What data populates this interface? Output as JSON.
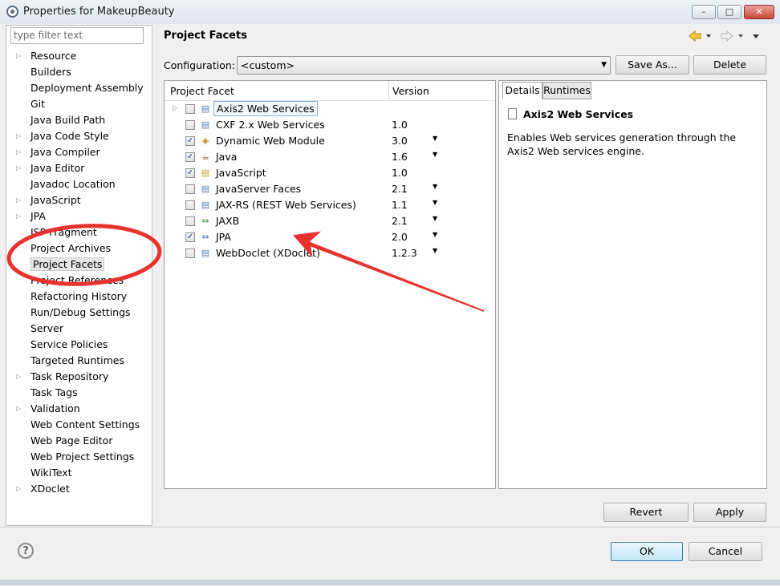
{
  "window": {
    "title": "Properties for MakeupBeauty",
    "minimize": "–",
    "maximize": "□",
    "close": "✕"
  },
  "sidebar": {
    "filter_placeholder": "type filter text",
    "items": [
      {
        "label": "Resource",
        "expandable": true
      },
      {
        "label": "Builders",
        "expandable": false
      },
      {
        "label": "Deployment Assembly",
        "expandable": false
      },
      {
        "label": "Git",
        "expandable": false
      },
      {
        "label": "Java Build Path",
        "expandable": false
      },
      {
        "label": "Java Code Style",
        "expandable": true
      },
      {
        "label": "Java Compiler",
        "expandable": true
      },
      {
        "label": "Java Editor",
        "expandable": true
      },
      {
        "label": "Javadoc Location",
        "expandable": false
      },
      {
        "label": "JavaScript",
        "expandable": true
      },
      {
        "label": "JPA",
        "expandable": true
      },
      {
        "label": "JSP Fragment",
        "expandable": false
      },
      {
        "label": "Project Archives",
        "expandable": false
      },
      {
        "label": "Project Facets",
        "expandable": false,
        "selected": true
      },
      {
        "label": "Project References",
        "expandable": false
      },
      {
        "label": "Refactoring History",
        "expandable": false
      },
      {
        "label": "Run/Debug Settings",
        "expandable": false
      },
      {
        "label": "Server",
        "expandable": false
      },
      {
        "label": "Service Policies",
        "expandable": false
      },
      {
        "label": "Targeted Runtimes",
        "expandable": false
      },
      {
        "label": "Task Repository",
        "expandable": true
      },
      {
        "label": "Task Tags",
        "expandable": false
      },
      {
        "label": "Validation",
        "expandable": true
      },
      {
        "label": "Web Content Settings",
        "expandable": false
      },
      {
        "label": "Web Page Editor",
        "expandable": false
      },
      {
        "label": "Web Project Settings",
        "expandable": false
      },
      {
        "label": "WikiText",
        "expandable": false
      },
      {
        "label": "XDoclet",
        "expandable": true
      }
    ]
  },
  "page": {
    "title": "Project Facets",
    "configuration_label": "Configuration:",
    "configuration_value": "<custom>",
    "save_as": "Save As...",
    "delete": "Delete"
  },
  "facets": {
    "col_facet": "Project Facet",
    "col_version": "Version",
    "rows": [
      {
        "name": "Axis2 Web Services",
        "version": "",
        "checked": false,
        "icon": "page-icon",
        "expander": true,
        "dropdown": false,
        "focused": true
      },
      {
        "name": "CXF 2.x Web Services",
        "version": "1.0",
        "checked": false,
        "icon": "page-icon",
        "dropdown": false
      },
      {
        "name": "Dynamic Web Module",
        "version": "3.0",
        "checked": true,
        "icon": "web-module-icon",
        "dropdown": true
      },
      {
        "name": "Java",
        "version": "1.6",
        "checked": true,
        "icon": "java-icon",
        "dropdown": true
      },
      {
        "name": "JavaScript",
        "version": "1.0",
        "checked": true,
        "icon": "javascript-icon",
        "dropdown": false
      },
      {
        "name": "JavaServer Faces",
        "version": "2.1",
        "checked": false,
        "icon": "page-icon",
        "dropdown": true
      },
      {
        "name": "JAX-RS (REST Web Services)",
        "version": "1.1",
        "checked": false,
        "icon": "page-icon",
        "dropdown": true
      },
      {
        "name": "JAXB",
        "version": "2.1",
        "checked": false,
        "icon": "jaxb-icon",
        "dropdown": true
      },
      {
        "name": "JPA",
        "version": "2.0",
        "checked": true,
        "icon": "jpa-icon",
        "dropdown": true
      },
      {
        "name": "WebDoclet (XDoclet)",
        "version": "1.2.3",
        "checked": false,
        "icon": "page-icon",
        "dropdown": true
      }
    ]
  },
  "details": {
    "tab_details": "Details",
    "tab_runtimes": "Runtimes",
    "title": "Axis2 Web Services",
    "description": "Enables Web services generation through the Axis2 Web services engine."
  },
  "buttons": {
    "revert": "Revert",
    "apply": "Apply",
    "ok": "OK",
    "cancel": "Cancel",
    "help": "?"
  },
  "colors": {
    "annotation": "#e8322d",
    "checkmark": "#1e3f7a"
  }
}
